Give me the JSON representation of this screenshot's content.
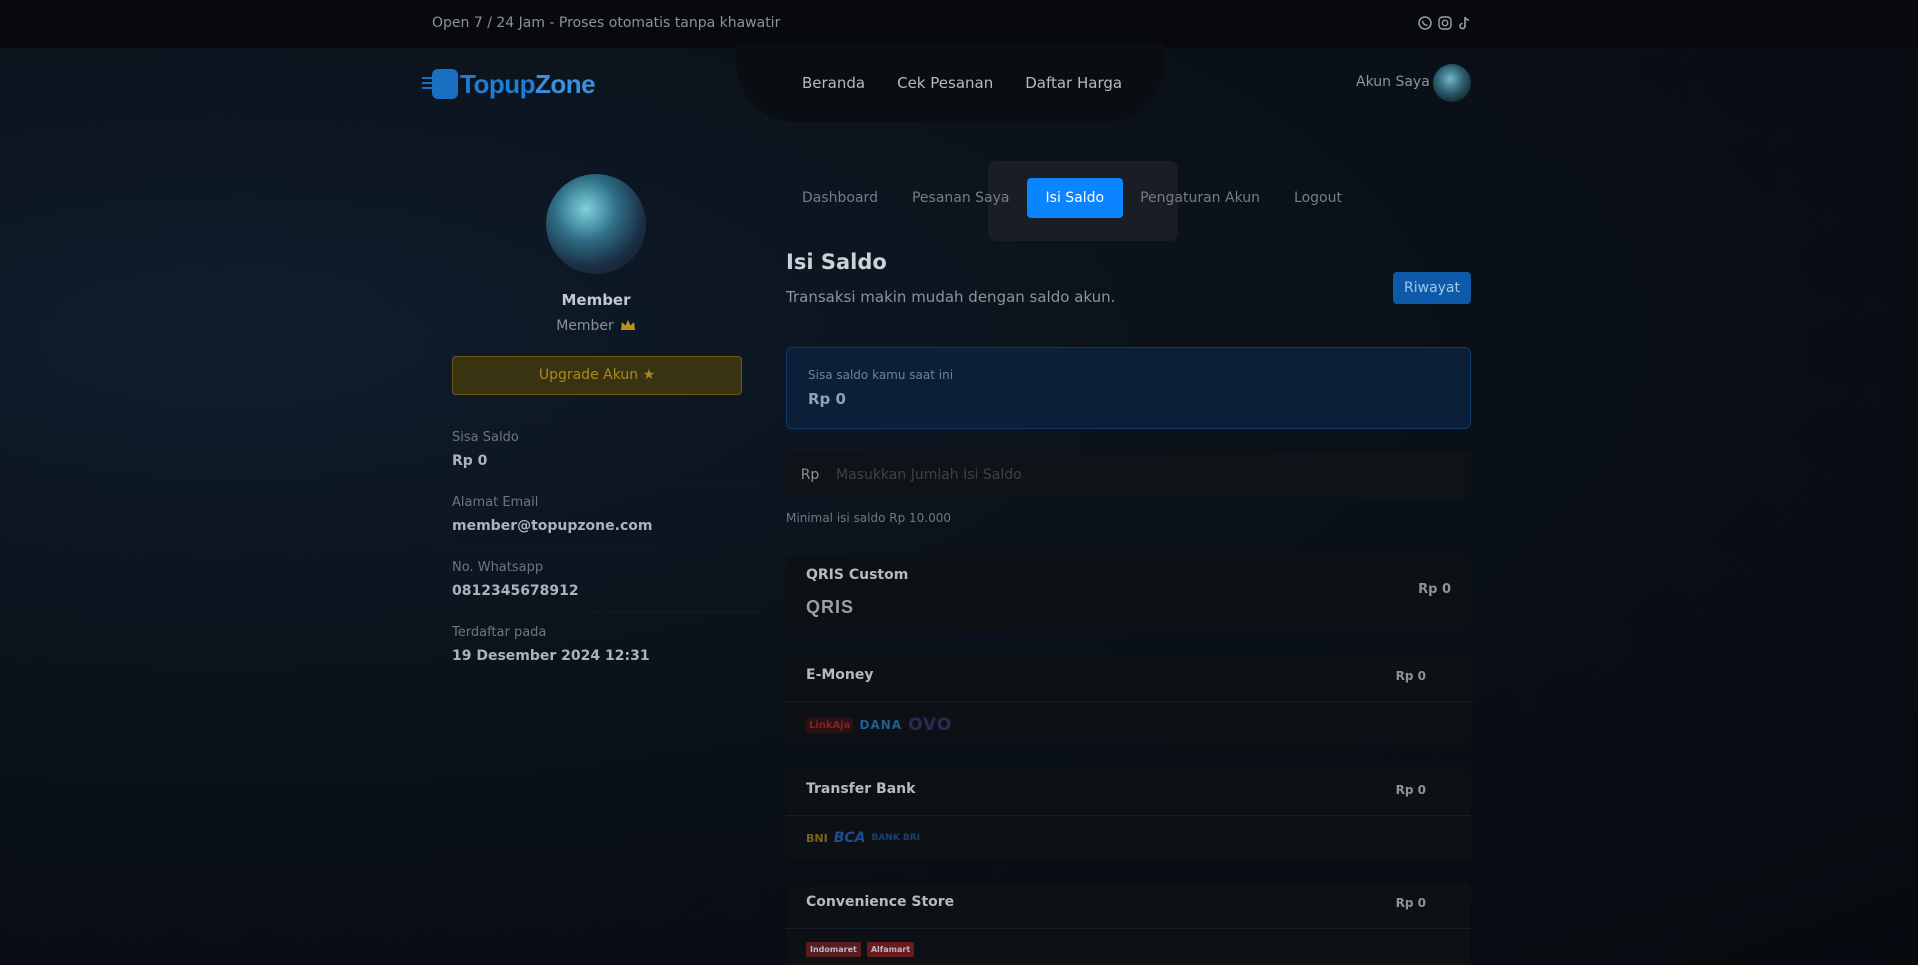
{
  "topbar": {
    "tagline": "Open 7 / 24 Jam - Proses otomatis tanpa khawatir",
    "socials": [
      "whatsapp-icon",
      "instagram-icon",
      "tiktok-icon"
    ]
  },
  "brand": {
    "part1": "Topup",
    "part2": "Zone"
  },
  "nav": {
    "items": [
      "Beranda",
      "Cek Pesanan",
      "Daftar Harga"
    ],
    "account_label": "Akun Saya"
  },
  "profile": {
    "name": "Member",
    "tier": "Member",
    "upgrade_label": "Upgrade Akun",
    "info": [
      {
        "label": "Sisa Saldo",
        "value": "Rp 0"
      },
      {
        "label": "Alamat Email",
        "value": "member@topupzone.com"
      },
      {
        "label": "No. Whatsapp",
        "value": "0812345678912"
      },
      {
        "label": "Terdaftar pada",
        "value": "19 Desember 2024 12:31"
      }
    ]
  },
  "tabs": [
    "Dashboard",
    "Pesanan Saya",
    "Isi Saldo",
    "Pengaturan Akun",
    "Logout"
  ],
  "active_tab": "Isi Saldo",
  "main": {
    "title": "Isi Saldo",
    "subtitle": "Transaksi makin mudah dengan saldo akun.",
    "history_button": "Riwayat",
    "balance_label": "Sisa saldo kamu saat ini",
    "balance_value": "Rp 0",
    "amount_prefix": "Rp",
    "amount_placeholder": "Masukkan Jumlah Isi Saldo",
    "min_note": "Minimal isi saldo Rp 10.000"
  },
  "methods": [
    {
      "name": "QRIS Custom",
      "price": "Rp 0",
      "logos": [
        "QRIS"
      ]
    },
    {
      "name": "E-Money",
      "price": "Rp 0",
      "logos": [
        "LinkAja",
        "DANA",
        "OVO"
      ]
    },
    {
      "name": "Transfer Bank",
      "price": "Rp 0",
      "logos": [
        "BNI",
        "BCA",
        "BANK BRI"
      ]
    },
    {
      "name": "Convenience Store",
      "price": "Rp 0",
      "logos": [
        "Indomaret",
        "Alfamart"
      ]
    }
  ],
  "colors": {
    "accent": "#0a84ff",
    "upgrade_gold": "#a58b1f",
    "brand_blue": "#1f7dd6"
  }
}
